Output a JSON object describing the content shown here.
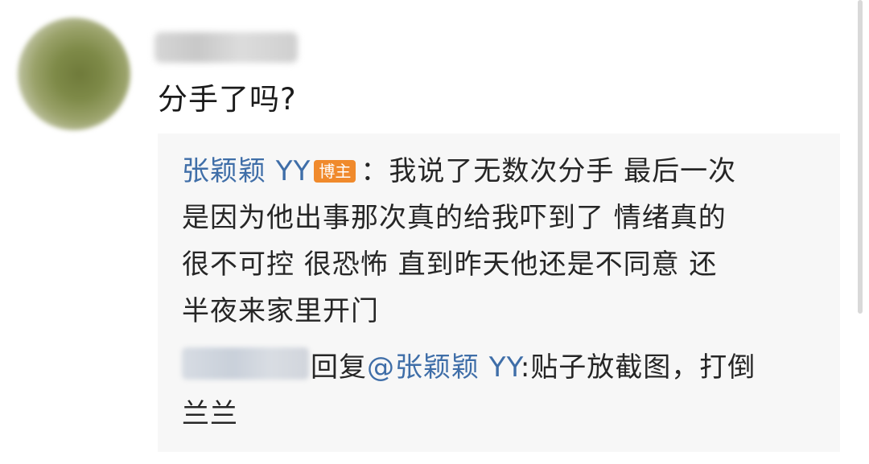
{
  "comment": {
    "text": "分手了吗?"
  },
  "reply": {
    "author": "张颖颖 YY",
    "author_badge": "博主",
    "separator": "：",
    "lines": [
      "我说了无数次分手 最后一次",
      "是因为他出事那次真的给我吓到了 情绪真的",
      "很不可控 很恐怖  直到昨天他还是不同意 还",
      "半夜来家里开门"
    ]
  },
  "sub_reply": {
    "verb": "回复",
    "mention": "@张颖颖 YY",
    "colon": ":",
    "text_line1": "贴子放截图，打倒",
    "text_line2": "兰兰"
  },
  "colors": {
    "link": "#3f6ea8",
    "badge": "#f08a2c",
    "reply_bg": "#f7f7f7"
  }
}
